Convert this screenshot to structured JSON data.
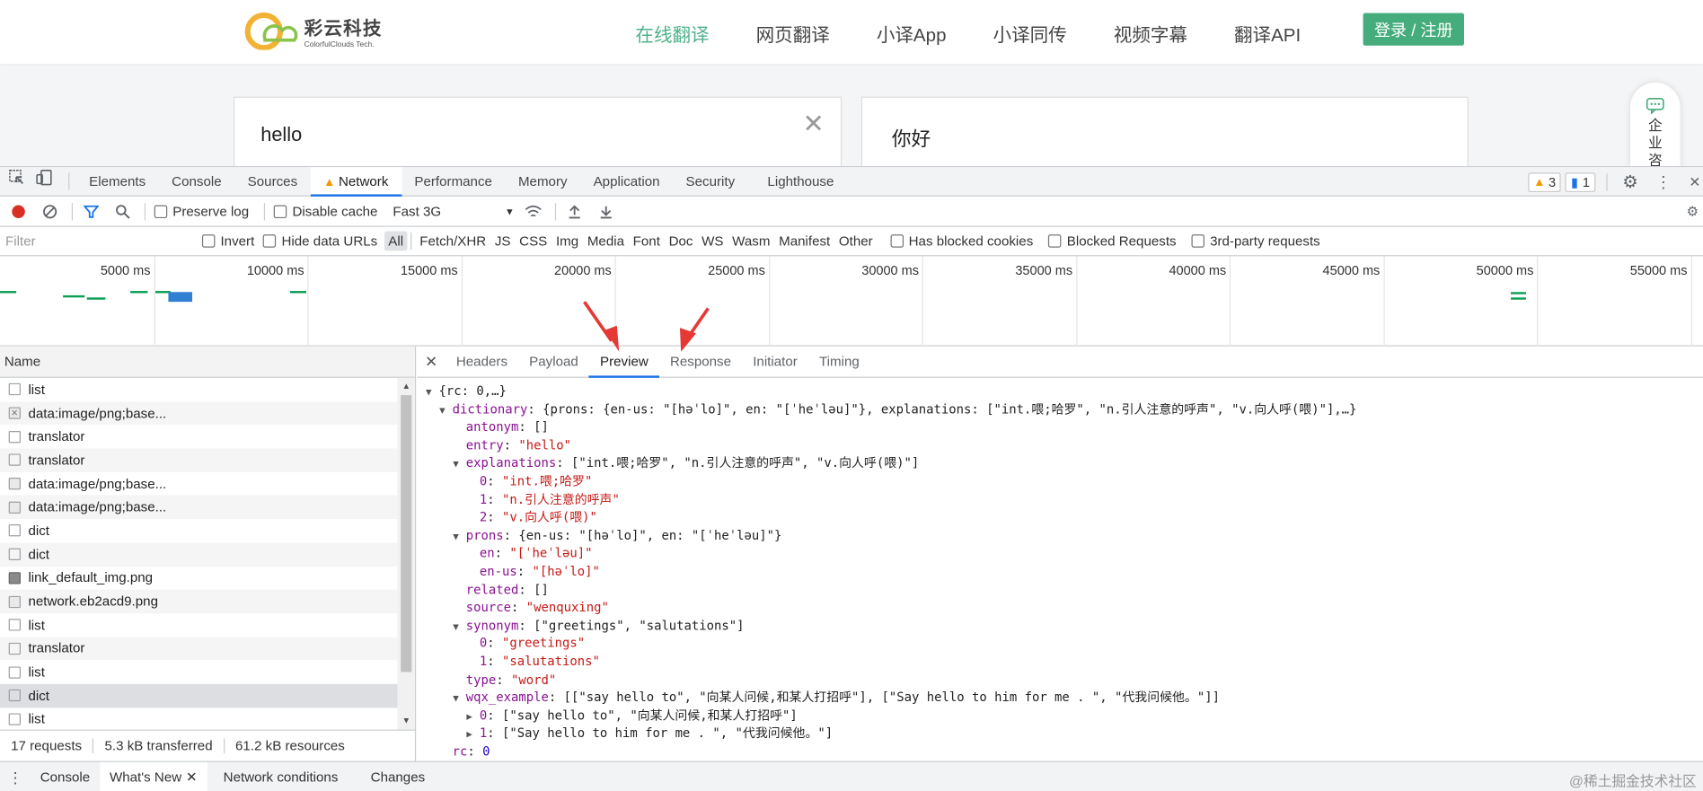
{
  "site": {
    "logo_cn": "彩云科技",
    "logo_en": "ColorfulClouds Tech.",
    "nav": [
      "在线翻译",
      "网页翻译",
      "小译App",
      "小译同传",
      "视频字幕",
      "翻译API"
    ],
    "nav_active_index": 0,
    "login": "登录 / 注册",
    "source_text": "hello",
    "clear_glyph": "✕",
    "target_text": "你好",
    "enterprise": "企业咨"
  },
  "devtools": {
    "tabs": [
      "Elements",
      "Console",
      "Sources",
      "Network",
      "Performance",
      "Memory",
      "Application",
      "Security",
      "Lighthouse"
    ],
    "active_tab": "Network",
    "warning_count": "3",
    "message_count": "1",
    "toolbar": {
      "preserve_log": "Preserve log",
      "disable_cache": "Disable cache",
      "throttle": "Fast 3G"
    },
    "filter": {
      "placeholder": "Filter",
      "invert": "Invert",
      "hide_data_urls": "Hide data URLs",
      "types": [
        "All",
        "Fetch/XHR",
        "JS",
        "CSS",
        "Img",
        "Media",
        "Font",
        "Doc",
        "WS",
        "Wasm",
        "Manifest",
        "Other"
      ],
      "has_blocked_cookies": "Has blocked cookies",
      "blocked_requests": "Blocked Requests",
      "third_party": "3rd-party requests"
    },
    "timeline_labels": [
      "5000 ms",
      "10000 ms",
      "15000 ms",
      "20000 ms",
      "25000 ms",
      "30000 ms",
      "35000 ms",
      "40000 ms",
      "45000 ms",
      "50000 ms",
      "55000 ms"
    ],
    "name_header": "Name",
    "requests": [
      {
        "name": "list",
        "icon": "doc"
      },
      {
        "name": "data:image/png;base...",
        "icon": "img-x"
      },
      {
        "name": "translator",
        "icon": "doc"
      },
      {
        "name": "translator",
        "icon": "doc"
      },
      {
        "name": "data:image/png;base...",
        "icon": "img"
      },
      {
        "name": "data:image/png;base...",
        "icon": "img"
      },
      {
        "name": "dict",
        "icon": "doc"
      },
      {
        "name": "dict",
        "icon": "doc"
      },
      {
        "name": "link_default_img.png",
        "icon": "pic"
      },
      {
        "name": "network.eb2acd9.png",
        "icon": "img"
      },
      {
        "name": "list",
        "icon": "doc"
      },
      {
        "name": "translator",
        "icon": "doc"
      },
      {
        "name": "list",
        "icon": "doc"
      },
      {
        "name": "dict",
        "icon": "doc"
      },
      {
        "name": "list",
        "icon": "doc"
      }
    ],
    "selected_request_index": 13,
    "status": {
      "requests": "17 requests",
      "transferred": "5.3 kB transferred",
      "resources": "61.2 kB resources"
    },
    "detail_tabs": [
      "Headers",
      "Payload",
      "Preview",
      "Response",
      "Initiator",
      "Timing"
    ],
    "active_detail_tab": "Preview",
    "drawer_tabs": [
      "Console",
      "What's New",
      "Network conditions",
      "Changes"
    ],
    "active_drawer_tab": "What's New",
    "watermark": "@稀土掘金技术社区"
  },
  "preview_lines": [
    {
      "indent": 0,
      "tri": "▼",
      "html": "{rc: 0,…}"
    },
    {
      "indent": 1,
      "tri": "▼",
      "key": "dictionary",
      "html": "{prons: {en-us: \"[həˈlo]\", en: \"[ˈheˈləu]\"}, explanations: [\"int.喂;哈罗\", \"n.引人注意的呼声\", \"v.向人呼(喂)\"],…}"
    },
    {
      "indent": 2,
      "tri": "",
      "key": "antonym",
      "html": "[]"
    },
    {
      "indent": 2,
      "tri": "",
      "key": "entry",
      "str": "\"hello\""
    },
    {
      "indent": 2,
      "tri": "▼",
      "key": "explanations",
      "html": "[\"int.喂;哈罗\", \"n.引人注意的呼声\", \"v.向人呼(喂)\"]"
    },
    {
      "indent": 3,
      "tri": "",
      "key": "0",
      "str": "\"int.喂;哈罗\""
    },
    {
      "indent": 3,
      "tri": "",
      "key": "1",
      "str": "\"n.引人注意的呼声\""
    },
    {
      "indent": 3,
      "tri": "",
      "key": "2",
      "str": "\"v.向人呼(喂)\""
    },
    {
      "indent": 2,
      "tri": "▼",
      "key": "prons",
      "html": "{en-us: \"[həˈlo]\", en: \"[ˈheˈləu]\"}"
    },
    {
      "indent": 3,
      "tri": "",
      "key": "en",
      "str": "\"[ˈheˈləu]\""
    },
    {
      "indent": 3,
      "tri": "",
      "key": "en-us",
      "str": "\"[həˈlo]\""
    },
    {
      "indent": 2,
      "tri": "",
      "key": "related",
      "html": "[]"
    },
    {
      "indent": 2,
      "tri": "",
      "key": "source",
      "str": "\"wenquxing\""
    },
    {
      "indent": 2,
      "tri": "▼",
      "key": "synonym",
      "html": "[\"greetings\", \"salutations\"]"
    },
    {
      "indent": 3,
      "tri": "",
      "key": "0",
      "str": "\"greetings\""
    },
    {
      "indent": 3,
      "tri": "",
      "key": "1",
      "str": "\"salutations\""
    },
    {
      "indent": 2,
      "tri": "",
      "key": "type",
      "str": "\"word\""
    },
    {
      "indent": 2,
      "tri": "▼",
      "key": "wqx_example",
      "html": "[[\"say hello to\", \"向某人问候,和某人打招呼\"], [\"Say hello to him for me . \", \"代我问候他。\"]]"
    },
    {
      "indent": 3,
      "tri": "▶",
      "key": "0",
      "html": "[\"say hello to\", \"向某人问候,和某人打招呼\"]"
    },
    {
      "indent": 3,
      "tri": "▶",
      "key": "1",
      "html": "[\"Say hello to him for me . \", \"代我问候他。\"]"
    },
    {
      "indent": 1,
      "tri": "",
      "key": "rc",
      "num": "0"
    }
  ],
  "colors": {
    "brand_green": "#45ad7b",
    "nav_active": "#4fb18a",
    "devtools_blue": "#1a73e8",
    "record_red": "#d93025",
    "arrow_red": "#e53935"
  }
}
